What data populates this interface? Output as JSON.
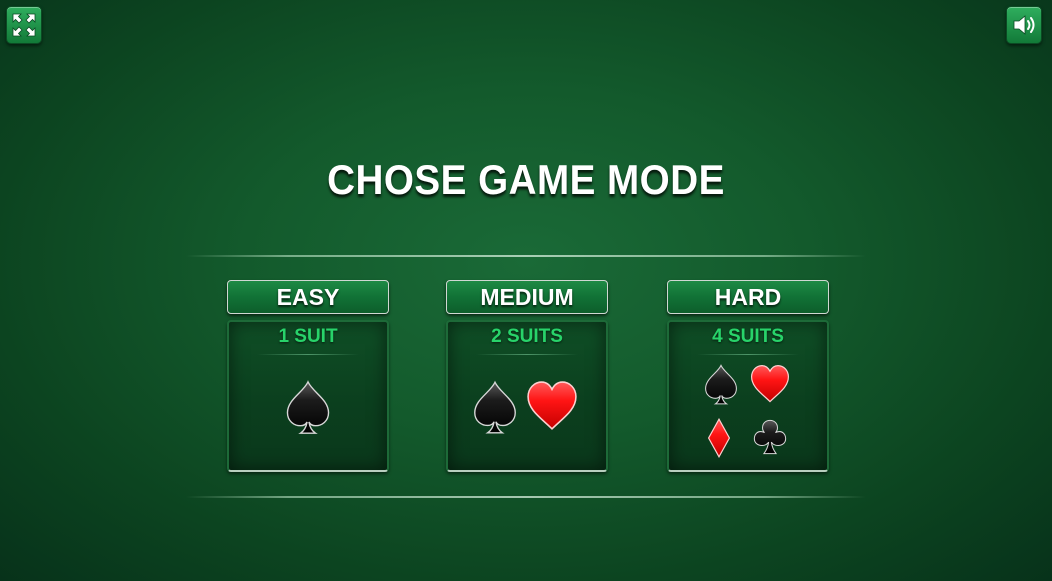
{
  "title": "CHOSE GAME MODE",
  "icons": {
    "fullscreen": "fullscreen-arrows-icon",
    "sound": "speaker-icon"
  },
  "colors": {
    "accent_green": "#28d36a",
    "table_green": "#135a2c",
    "suit_red": "#ff1a1a",
    "suit_black": "#111111"
  },
  "modes": [
    {
      "label": "EASY",
      "suits_label": "1 SUIT",
      "suits": [
        "spade"
      ]
    },
    {
      "label": "MEDIUM",
      "suits_label": "2 SUITS",
      "suits": [
        "spade",
        "heart"
      ]
    },
    {
      "label": "HARD",
      "suits_label": "4 SUITS",
      "suits": [
        "spade",
        "heart",
        "diamond",
        "club"
      ]
    }
  ]
}
